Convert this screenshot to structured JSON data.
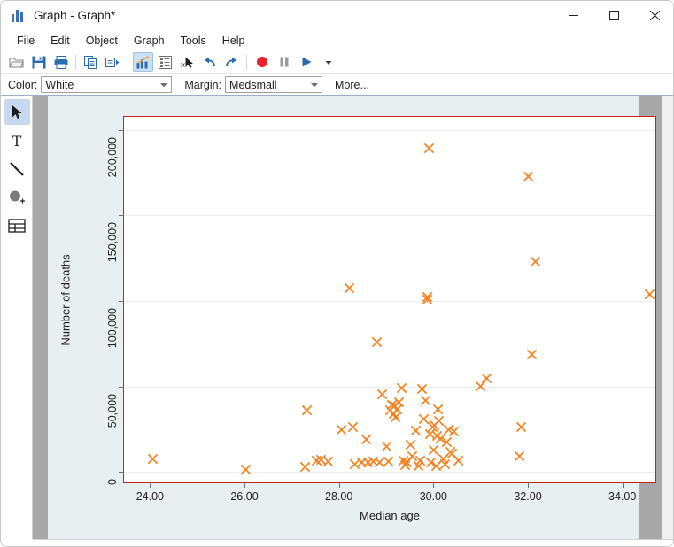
{
  "window": {
    "title": "Graph - Graph*",
    "icon": "graph-bars-icon",
    "controls": {
      "minimize": "–",
      "maximize": "☐",
      "close": "✕"
    }
  },
  "menubar": {
    "items": [
      {
        "label": "File"
      },
      {
        "label": "Edit"
      },
      {
        "label": "Object"
      },
      {
        "label": "Graph"
      },
      {
        "label": "Tools"
      },
      {
        "label": "Help"
      }
    ]
  },
  "toolbar": {
    "buttons": [
      {
        "name": "open-icon",
        "tip": "Open"
      },
      {
        "name": "save-icon",
        "tip": "Save"
      },
      {
        "name": "print-icon",
        "tip": "Print"
      },
      {
        "name": "copy-icon",
        "tip": "Copy"
      },
      {
        "name": "rename-icon",
        "tip": "Rename"
      },
      {
        "name": "start-graph-editor-icon",
        "tip": "Start Graph Editor",
        "active": true
      },
      {
        "name": "grid-edit-icon",
        "tip": "Grid edit"
      },
      {
        "name": "deselect-pointer-icon",
        "tip": "Deselect"
      },
      {
        "name": "undo-icon",
        "tip": "Undo"
      },
      {
        "name": "redo-icon",
        "tip": "Redo"
      },
      {
        "name": "record-icon",
        "tip": "Record"
      },
      {
        "name": "pause-icon",
        "tip": "Pause"
      },
      {
        "name": "play-icon",
        "tip": "Play"
      },
      {
        "name": "dropdown-arrow-icon",
        "tip": "More"
      }
    ]
  },
  "options": {
    "color_label": "Color:",
    "color_value": "White",
    "margin_label": "Margin:",
    "margin_value": "Medsmall",
    "more_label": "More..."
  },
  "palette": {
    "tools": [
      {
        "name": "pointer-tool",
        "label": "Select",
        "active": true
      },
      {
        "name": "text-tool",
        "label": "Add Text"
      },
      {
        "name": "line-tool",
        "label": "Add Line"
      },
      {
        "name": "marker-tool",
        "label": "Add Marker"
      },
      {
        "name": "grid-tool",
        "label": "Grid"
      }
    ]
  },
  "chart_data": {
    "type": "scatter",
    "title": "",
    "xlabel": "Median age",
    "ylabel": "Number of deaths",
    "xlim": [
      23.45,
      34.7
    ],
    "ylim": [
      -6000,
      207500
    ],
    "xticks": [
      24,
      26,
      28,
      30,
      32,
      34
    ],
    "xticklabels": [
      "24.00",
      "26.00",
      "28.00",
      "30.00",
      "32.00",
      "34.00"
    ],
    "yticks": [
      0,
      50000,
      100000,
      150000,
      200000
    ],
    "yticklabels": [
      "0",
      "50,000",
      "100,000",
      "150,000",
      "200,000"
    ],
    "grid": "horizontal",
    "legend": null,
    "marker_symbol": "X",
    "marker_color": "#f58220",
    "plot_border_color": "#c81e1e",
    "plot_bg": "#ffffff",
    "graph_bg": "#e8eff1",
    "points": [
      [
        24.05,
        7500
      ],
      [
        26.03,
        1500
      ],
      [
        27.28,
        3000
      ],
      [
        27.33,
        36000
      ],
      [
        27.52,
        6500
      ],
      [
        27.62,
        7000
      ],
      [
        27.78,
        6000
      ],
      [
        28.05,
        25000
      ],
      [
        28.22,
        107500
      ],
      [
        28.3,
        26500
      ],
      [
        28.33,
        4500
      ],
      [
        28.48,
        5500
      ],
      [
        28.58,
        19000
      ],
      [
        28.62,
        5500
      ],
      [
        28.73,
        6000
      ],
      [
        28.8,
        76000
      ],
      [
        28.86,
        5500
      ],
      [
        28.92,
        45500
      ],
      [
        29.0,
        15000
      ],
      [
        29.05,
        6000
      ],
      [
        29.08,
        36000
      ],
      [
        29.12,
        39000
      ],
      [
        29.15,
        34000
      ],
      [
        29.18,
        38500
      ],
      [
        29.2,
        32000
      ],
      [
        29.24,
        36500
      ],
      [
        29.28,
        41000
      ],
      [
        29.32,
        49000
      ],
      [
        29.36,
        6500
      ],
      [
        29.4,
        4000
      ],
      [
        29.44,
        5500
      ],
      [
        29.52,
        16000
      ],
      [
        29.56,
        9000
      ],
      [
        29.62,
        24000
      ],
      [
        29.68,
        3500
      ],
      [
        29.72,
        6500
      ],
      [
        29.76,
        48500
      ],
      [
        29.8,
        31000
      ],
      [
        29.84,
        42000
      ],
      [
        29.88,
        100500
      ],
      [
        29.88,
        102500
      ],
      [
        29.9,
        189000
      ],
      [
        29.92,
        22000
      ],
      [
        29.95,
        5500
      ],
      [
        29.98,
        26500
      ],
      [
        30.0,
        13000
      ],
      [
        30.02,
        27500
      ],
      [
        30.05,
        3500
      ],
      [
        30.08,
        21000
      ],
      [
        30.1,
        36500
      ],
      [
        30.12,
        30000
      ],
      [
        30.16,
        19500
      ],
      [
        30.2,
        7500
      ],
      [
        30.24,
        4500
      ],
      [
        30.28,
        17500
      ],
      [
        30.32,
        25000
      ],
      [
        30.36,
        12000
      ],
      [
        30.4,
        11000
      ],
      [
        30.44,
        23500
      ],
      [
        30.52,
        6500
      ],
      [
        31.0,
        50000
      ],
      [
        31.12,
        55000
      ],
      [
        31.82,
        9000
      ],
      [
        31.86,
        26500
      ],
      [
        32.0,
        172500
      ],
      [
        32.08,
        68500
      ],
      [
        32.16,
        123000
      ],
      [
        34.57,
        104000
      ]
    ]
  }
}
